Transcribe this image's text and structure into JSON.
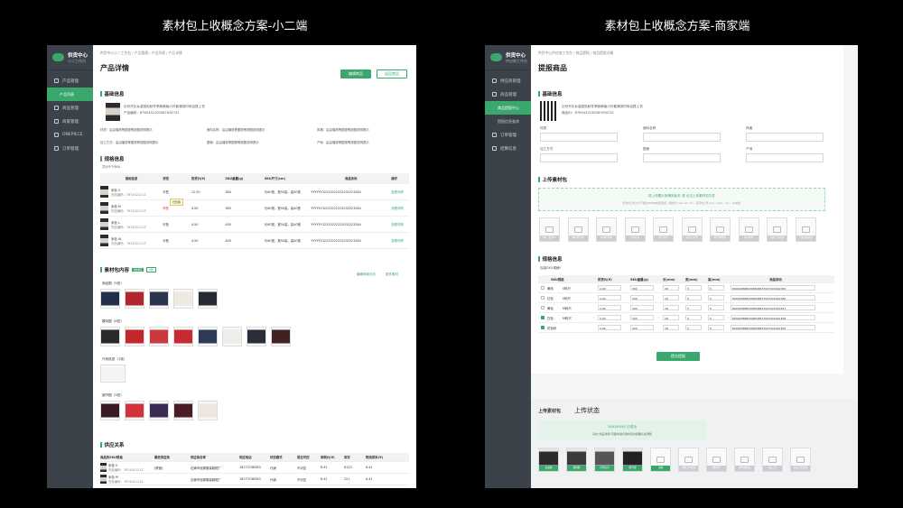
{
  "captions": {
    "left": "素材包上收概念方案-小二端",
    "right": "素材包上收概念方案-商家端"
  },
  "left": {
    "logo": {
      "title": "供货中心",
      "subtitle": "小二工作台"
    },
    "nav": [
      {
        "label": "产品管理",
        "active": false
      },
      {
        "label": "产品列表",
        "active": true
      },
      {
        "label": "商品管理",
        "active": false
      },
      {
        "label": "商家管理",
        "active": false
      },
      {
        "label": "ONEPIECE",
        "active": false
      },
      {
        "label": "订单管理",
        "active": false
      }
    ],
    "breadcrumb": "供货中心小二工作台  /  产品管理  /  产品列表  /  产品详情",
    "page_title": "产品详情",
    "edit_button": "编辑商品",
    "back_button": "返回商品",
    "basic_section": "基础信息",
    "product_name": "针织开衫女装宽松秋冬季款韩版小外套潮流时尚百搭上衣",
    "product_code": "产品编码：8765432100087634741",
    "attrs": [
      {
        "k": "材质",
        "v": "由由播放等图按等按图说明提示"
      },
      {
        "k": "面料名称",
        "v": "由由播放等图按等按图说明提示"
      },
      {
        "k": "风格",
        "v": "由由播放等图按等按图说明提示"
      },
      {
        "k": "加工方式",
        "v": "由由播放等图按等按图说明提示"
      },
      {
        "k": "图案",
        "v": "由由播放等图按等按图说明提示"
      },
      {
        "k": "产地",
        "v": "由由播放等图按等按图说明提示"
      }
    ],
    "spec_section": "规格信息",
    "spec_count": "共计5个SKU",
    "spec_headers": [
      "基础信息",
      "状态",
      "供货价(¥)",
      "SKU重量(g)",
      "SKU尺寸(cm)",
      "商品条码",
      "操作"
    ],
    "spec_rows": [
      {
        "name": "米色 S",
        "code": "货品编码：767442121Z",
        "status": "可售",
        "price": "12.50",
        "weight": "380",
        "size": "长60宽，宽50高，高40宽",
        "barcode": "YYYYYY32223222222032223344",
        "op": "查看详情"
      },
      {
        "name": "米色 M",
        "code": "货品编码：767442121Z",
        "status": "停售",
        "price": "4.50",
        "weight": "365",
        "size": "长60宽，宽50高，高40宽",
        "barcode": "YYYYYY32223222222032223344",
        "op": "查看详情"
      },
      {
        "name": "米色 L",
        "code": "货品编码：767442121Z",
        "status": "可售",
        "price": "4.50",
        "weight": "A55",
        "size": "长60宽，宽50高，高40宽",
        "barcode": "YYYYYY32223222222032223344",
        "op": "查看详情"
      },
      {
        "name": "米色 XL",
        "code": "货品编码：767442121Z",
        "status": "可售",
        "price": "4.50",
        "weight": "A55",
        "size": "长60宽，宽50高，高40宽",
        "barcode": "YYYYYY32223222222032223344",
        "op": "查看详情"
      }
    ],
    "tooltip": "已售罄",
    "material_section": "素材包内容",
    "material_badges": [
      "素材包",
      "2套"
    ],
    "material_links": [
      "编辑商家补充",
      "更多素材"
    ],
    "groups": [
      {
        "label": "商品图（5张）",
        "count": 5
      },
      {
        "label": "模特图（8张）",
        "count": 8
      },
      {
        "label": "尺码信息（1张）",
        "count": 1
      },
      {
        "label": "细节图（5张）",
        "count": 5
      }
    ],
    "supply_section": "供应关系",
    "supply_headers": [
      "商品的SKU规格",
      "最低供应商",
      "供应商名称",
      "供应电话",
      "状态模式",
      "是否可控",
      "采购价(¥)",
      "库存",
      "物流成本(¥)"
    ],
    "supply_rows": [
      {
        "name": "米色 S",
        "code": "货品编码：767442121Z",
        "min": "[联营]",
        "vendor": "石狮市旭源服装鞋帽厂",
        "phone": "18273748383",
        "mode": "代销",
        "ctrl": "不可控",
        "price": "8.41",
        "stock": "8123",
        "cost": "8.41"
      },
      {
        "name": "米色 M",
        "code": "货品编码：767442121Z",
        "min": "",
        "vendor": "石狮市旭源服装鞋帽厂",
        "phone": "18273748383",
        "mode": "代销",
        "ctrl": "不可控",
        "price": "8.41",
        "stock": "221",
        "cost": "8.41"
      }
    ]
  },
  "right": {
    "logo": {
      "title": "供货中心",
      "subtitle": "供应商工作台"
    },
    "nav": [
      {
        "label": "供应商管理",
        "active": false
      },
      {
        "label": "商品管理",
        "active": false
      },
      {
        "label": "商品提报中心",
        "active": true
      },
      {
        "label": "提报信息查询",
        "active": false
      },
      {
        "label": "订单管理",
        "active": false
      },
      {
        "label": "结算信息",
        "active": false
      }
    ],
    "breadcrumb": "供货中心供应商工作台  /  商品提报  /  商品提报详情",
    "page_title": "提报商品",
    "basic_section": "基础信息",
    "product_name": "针织开衫女装宽松秋冬季款韩版小外套潮流时尚百搭上衣",
    "product_code": "商品ID：8765432100087634741",
    "fields": [
      "材质",
      "面料名称",
      "风格",
      "加工方式",
      "图案",
      "产地"
    ],
    "upload_section": "上传素材包",
    "upload_hint": "将上传图片拖拽到此处  或 点击上传素材包文件",
    "upload_note": "仅支持上传大小不超过500MB的压缩包（格式为 .zip/.rar/.7z），可同时上传 img , mp4 , .rar , .zip格式",
    "upload_tiles": [
      "主图（最多5）",
      "面料细节图",
      "模特场景图",
      "尺码信息",
      "细节信息",
      "商品上架图",
      "细节图视频",
      "素材视频",
      "商品上架视频",
      "全量商品视频"
    ],
    "spec_section": "规格信息",
    "spec_note": "包装SKU规格*",
    "spec_headers": [
      "SKU规格",
      "供货价(¥)",
      "SKU重量(g)",
      "长(mm)",
      "宽(mm)",
      "高(mm)",
      "商品条码"
    ],
    "spec_rows": [
      {
        "checked": false,
        "color": "黄色",
        "size": "S码尺",
        "price": "4.90",
        "weight": "300",
        "l": "18",
        "w": "5",
        "h": "5",
        "barcode": "8000038880398548637023324412305"
      },
      {
        "checked": false,
        "color": "红色",
        "size": "S码尺",
        "price": "4.90",
        "weight": "300",
        "l": "18",
        "w": "5",
        "h": "5",
        "barcode": "8000038880398548637023324412306"
      },
      {
        "checked": false,
        "color": "黄色",
        "size": "M码尺",
        "price": "4.90",
        "weight": "300",
        "l": "18",
        "w": "5",
        "h": "5",
        "barcode": "8000038880398548637023324412307"
      },
      {
        "checked": true,
        "color": "白色",
        "size": "M码尺",
        "price": "4.90",
        "weight": "300",
        "l": "18",
        "w": "5",
        "h": "5",
        "barcode": "8000038880398548637023324412308"
      },
      {
        "checked": true,
        "color": "花色码",
        "size": "",
        "price": "4.90",
        "weight": "300",
        "l": "18",
        "w": "5",
        "h": "5",
        "barcode": "8000038880398548637023324412309"
      }
    ],
    "submit_button": "提交提报",
    "status_tab1": "上传素材包",
    "status_tab2": "上传状态",
    "status_success": "XXXXXXXX 已成功",
    "status_note": "请在\"商品详情\"页面中进行素材包内容确认和调整",
    "status_tiles": [
      "商品图",
      "模特图",
      "尺码信息",
      "细节图",
      "主图",
      "主图上传视频",
      "面料细节",
      "模特图视频",
      "商品上架",
      "商品上架视频"
    ]
  },
  "colors": {
    "accent": "#3aa76d",
    "sidebar": "#3b4249",
    "canvas": "#000000"
  }
}
